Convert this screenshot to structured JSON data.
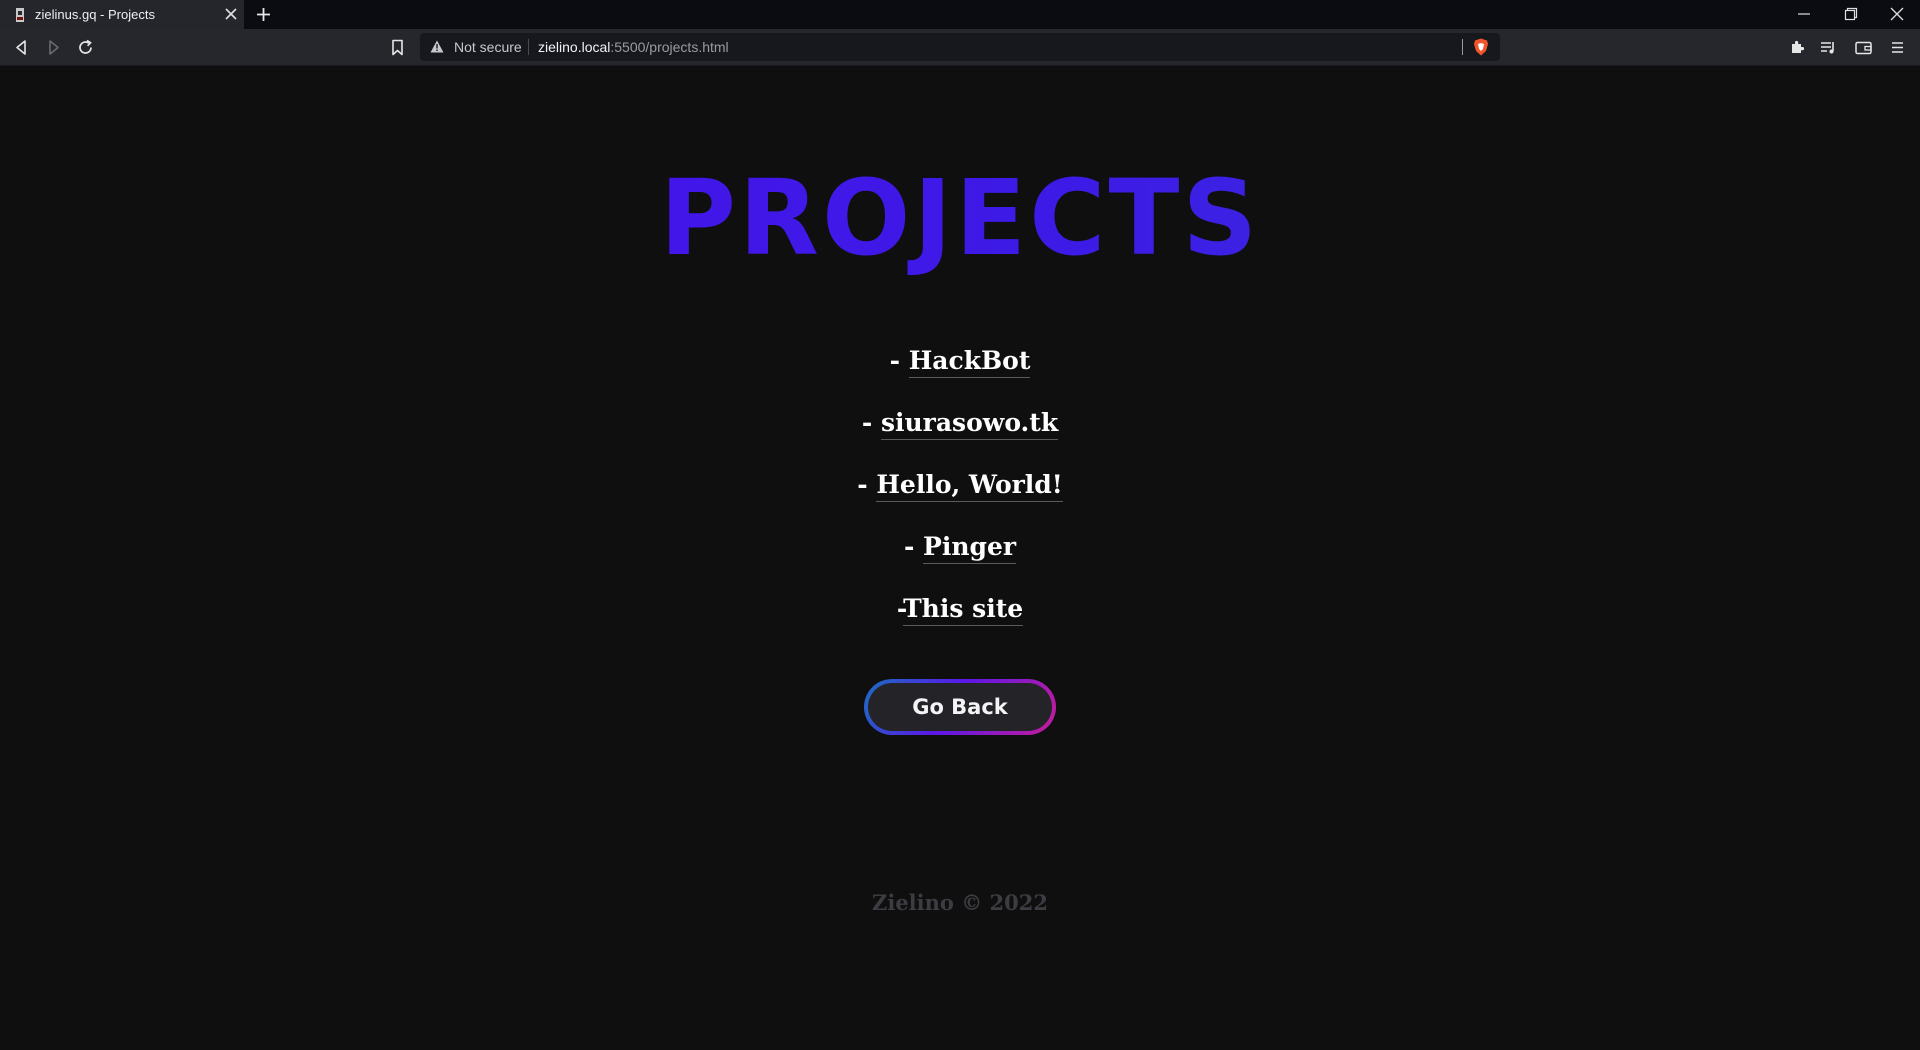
{
  "browser": {
    "tab": {
      "title": "zielinus.gq - Projects"
    },
    "url": {
      "security_label": "Not secure",
      "host": "zielino.local",
      "path": ":5500/projects.html"
    },
    "icons": {
      "back": "back-arrow-icon",
      "forward": "forward-arrow-icon",
      "reload": "reload-icon",
      "bookmark": "bookmark-icon",
      "shields": "brave-shield-icon",
      "extensions": "puzzle-icon",
      "playlist": "playlist-icon",
      "wallet": "wallet-icon",
      "menu": "hamburger-menu-icon"
    }
  },
  "page": {
    "title": "PROJECTS",
    "title_gradient": [
      "#4a10ee",
      "#3a3ad8"
    ],
    "projects": [
      {
        "prefix": "- ",
        "label": "HackBot"
      },
      {
        "prefix": "- ",
        "label": "siurasowo.tk"
      },
      {
        "prefix": "- ",
        "label": "Hello, World!"
      },
      {
        "prefix": "- ",
        "label": "Pinger"
      },
      {
        "prefix": "-",
        "label": "This site"
      }
    ],
    "button": {
      "label": "Go Back"
    },
    "footer": "Zielino © 2022"
  }
}
